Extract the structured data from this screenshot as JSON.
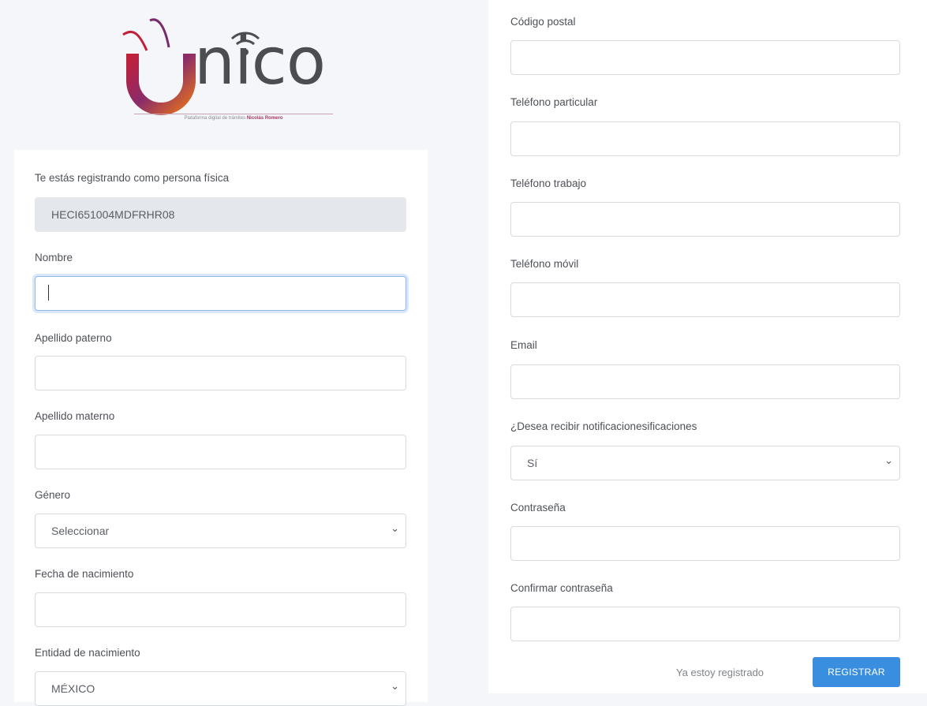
{
  "brand": {
    "wordmark": "nico",
    "tagline_prefix": "Plataforma digital de trámites",
    "tagline_strong": "Nicolás Romero",
    "colors": {
      "accent_red": "#c2203a",
      "accent_purple": "#7a2a6a",
      "accent_orange": "#e2701f",
      "wordmark": "#4b4d50"
    }
  },
  "left_form": {
    "intro_label": "Te estás registrando como persona física",
    "rfc_value": "HECI651004MDFRHR08",
    "nombre_label": "Nombre",
    "nombre_value": "",
    "apellido_paterno_label": "Apellido paterno",
    "apellido_materno_label": "Apellido materno",
    "genero_label": "Género",
    "genero_selected": "Seleccionar",
    "fecha_label": "Fecha de nacimiento",
    "entidad_label": "Entidad de nacimiento",
    "entidad_selected": "MÉXICO"
  },
  "right_form": {
    "codigo_postal_label": "Código postal",
    "tel_particular_label": "Teléfono particular",
    "tel_trabajo_label": "Teléfono trabajo",
    "tel_movil_label": "Teléfono móvil",
    "email_label": "Email",
    "notificaciones_label": "¿Desea recibir notificacionesificaciones",
    "notificaciones_selected": "Sí",
    "contrasena_label": "Contraseña",
    "confirmar_label": "Confirmar contraseña"
  },
  "actions": {
    "already_registered": "Ya estoy registrado",
    "register_button": "REGISTRAR",
    "button_color": "#3a8ee0"
  }
}
